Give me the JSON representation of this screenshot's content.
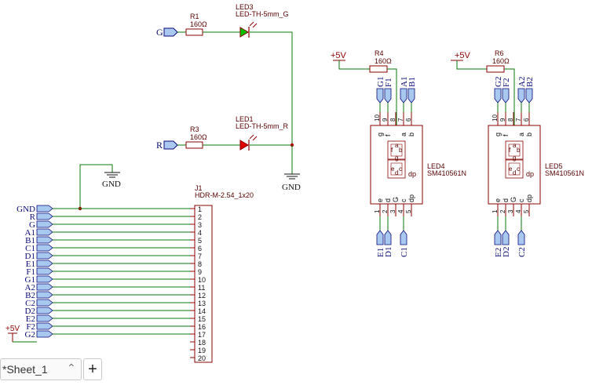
{
  "schematic": {
    "colors": {
      "wire": "#0b7a0b",
      "part": "#8b0000",
      "net": "#0a0a7a",
      "port_fill": "#a8c8f0",
      "led_green": "#00c000",
      "led_red": "#e00000"
    },
    "ports": {
      "g": "G",
      "r": "R"
    },
    "r1": {
      "ref": "R1",
      "value": "160Ω"
    },
    "r3": {
      "ref": "R3",
      "value": "160Ω"
    },
    "r4": {
      "ref": "R4",
      "value": "160Ω"
    },
    "r6": {
      "ref": "R6",
      "value": "160Ω"
    },
    "led3": {
      "ref": "LED3",
      "value": "LED-TH-5mm_G"
    },
    "led1": {
      "ref": "LED1",
      "value": "LED-TH-5mm_R"
    },
    "gnd_label": "GND",
    "vcc_label": "+5V",
    "j1": {
      "ref": "J1",
      "value": "HDR-M-2.54_1x20",
      "pin_numbers": [
        "1",
        "2",
        "3",
        "4",
        "5",
        "6",
        "7",
        "8",
        "9",
        "10",
        "11",
        "12",
        "13",
        "14",
        "15",
        "16",
        "17",
        "18",
        "19",
        "20"
      ],
      "nets": [
        "GND",
        "R",
        "G",
        "A1",
        "B1",
        "C1",
        "D1",
        "E1",
        "F1",
        "G1",
        "A2",
        "B2",
        "C2",
        "D2",
        "E2",
        "F2",
        "G2"
      ],
      "vcc": "+5V"
    },
    "led4": {
      "ref": "LED4",
      "value": "SM410561N",
      "top_nets": [
        "G1",
        "F1",
        "A1",
        "B1"
      ],
      "bottom_nets": [
        "E1",
        "D1",
        "C1"
      ],
      "top_pin_nums": [
        "10",
        "9",
        "8",
        "7",
        "6"
      ],
      "top_pin_names": [
        "g",
        "f",
        "a",
        "b"
      ],
      "bottom_pin_nums": [
        "1",
        "2",
        "3",
        "4",
        "5"
      ],
      "bottom_pin_names": [
        "e",
        "d",
        "G",
        "c",
        "dp"
      ]
    },
    "led5": {
      "ref": "LED5",
      "value": "SM410561N",
      "top_nets": [
        "G2",
        "F2",
        "A2",
        "B2"
      ],
      "bottom_nets": [
        "E2",
        "D2",
        "C2"
      ],
      "top_pin_nums": [
        "10",
        "9",
        "8",
        "7",
        "6"
      ],
      "top_pin_names": [
        "g",
        "f",
        "a",
        "b"
      ],
      "bottom_pin_nums": [
        "1",
        "2",
        "3",
        "4",
        "5"
      ],
      "bottom_pin_names": [
        "e",
        "d",
        "G",
        "c",
        "dp"
      ]
    },
    "seg_letters": [
      "a",
      "b",
      "c",
      "d",
      "e",
      "f",
      "g",
      "dp"
    ]
  },
  "tabs": {
    "sheet_label": "*Sheet_1",
    "chevron": "⌃",
    "add_label": "+"
  }
}
